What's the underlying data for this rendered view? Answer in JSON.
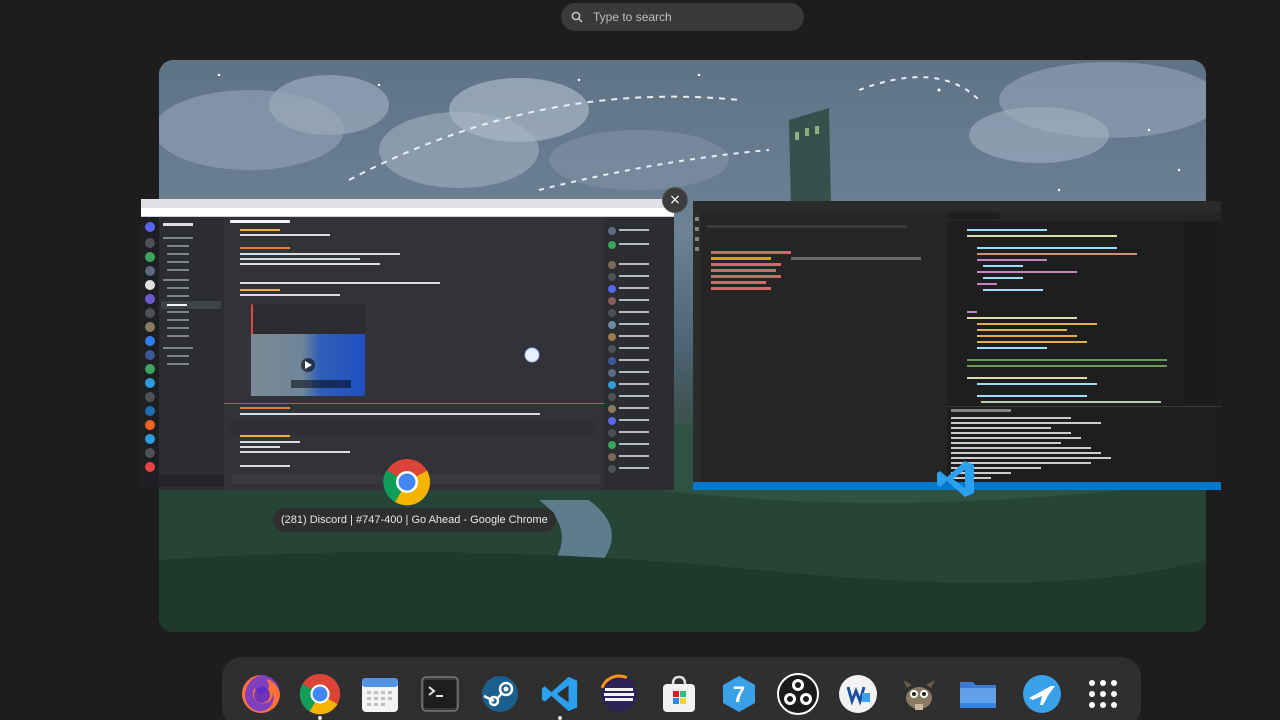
{
  "search": {
    "placeholder": "Type to search"
  },
  "overview": {
    "window_caption": "(281) Discord | #747-400 | Go Ahead - Google Chrome",
    "close_label": "×"
  },
  "colors": {
    "accent": "#007acc",
    "discord_bg": "#313338",
    "dock_bg": "#2f2f2f"
  },
  "dock": {
    "items": [
      {
        "name": "firefox",
        "icon": "firefox-icon"
      },
      {
        "name": "google-chrome",
        "icon": "chrome-icon",
        "running": true
      },
      {
        "name": "calendar",
        "icon": "calendar-icon"
      },
      {
        "name": "terminal",
        "icon": "terminal-icon"
      },
      {
        "name": "steam",
        "icon": "steam-icon"
      },
      {
        "name": "vscode",
        "icon": "vscode-icon",
        "running": true
      },
      {
        "name": "eclipse",
        "icon": "eclipse-icon"
      },
      {
        "name": "software-store",
        "icon": "store-icon"
      },
      {
        "name": "app-7",
        "icon": "blue-7-icon"
      },
      {
        "name": "obs-studio",
        "icon": "obs-icon"
      },
      {
        "name": "app-w",
        "icon": "w-icon"
      },
      {
        "name": "gimp",
        "icon": "gimp-icon"
      },
      {
        "name": "files",
        "icon": "folder-icon"
      },
      {
        "name": "flight-app",
        "icon": "plane-icon"
      },
      {
        "name": "show-apps",
        "icon": "app-grid-icon"
      }
    ]
  }
}
